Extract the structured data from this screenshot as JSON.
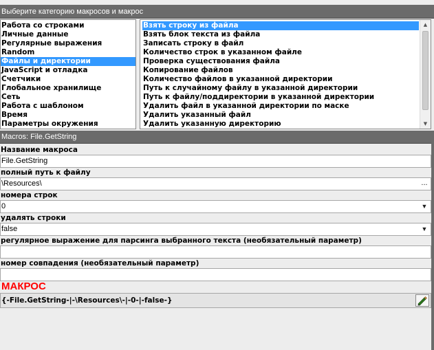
{
  "header": {
    "title": "Выберите категорию макросов и макрос"
  },
  "categories": {
    "selected_index": 4,
    "items": [
      "Работа со строками",
      "Личные данные",
      "Регулярные выражения",
      "Random",
      "Файлы и директории",
      "JavaScript и отладка",
      "Счетчики",
      "Глобальное хранилище",
      "Сеть",
      "Работа с шаблоном",
      "Время",
      "Параметры окружения"
    ]
  },
  "macros": {
    "selected_index": 0,
    "items": [
      "Взять строку из файла",
      "Взять блок текста из файла",
      "Записать строку в файл",
      "Количество строк в указанном файле",
      "Проверка существования файла",
      "Копирование файлов",
      "Количество файлов в указанной директории",
      "Путь к случайному файлу в указанной директории",
      "Путь к файлу/поддиректории в указанной директории",
      "Удалить файл в указанной директории по маске",
      "Удалить указанный файл",
      "Удалить указанную директорию"
    ]
  },
  "macro_panel": {
    "header": "Macros: File.GetString",
    "name_label": "Название макроса",
    "name_value": "File.GetString",
    "path_label": "полный путь к файлу",
    "path_value": "\\Resources\\",
    "path_button": "...",
    "lines_label": "номера строк",
    "lines_value": "0",
    "delete_label": "удалять строки",
    "delete_value": "false",
    "regex_label": "регулярное выражение для парсинга выбранного текста (необязательный параметр)",
    "regex_value": "",
    "match_label": "номер совпадения (необязательный параметр)",
    "match_value": "",
    "macro_title": "МАКРОС",
    "macro_code": "{-File.GetString-|-\\Resources\\-|-0-|-false-}"
  },
  "icons": {
    "dropdown": "chevron-down-icon",
    "browse": "ellipsis-icon",
    "copy": "pencil-icon",
    "scroll_up": "scroll-up-icon",
    "scroll_down": "scroll-down-icon"
  },
  "colors": {
    "selection": "#3399ff",
    "header_bg": "#6b6b6b",
    "macro_title": "#ff0000"
  }
}
